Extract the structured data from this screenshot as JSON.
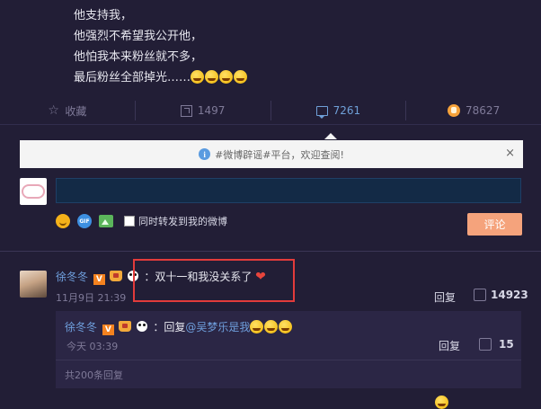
{
  "post": {
    "lines": [
      "他支持我，",
      "他强烈不希望我公开他，",
      "他怕我本来粉丝就不多，",
      "最后粉丝全部掉光……"
    ]
  },
  "actions": {
    "favorite": "收藏",
    "forward": "1497",
    "comment": "7261",
    "like": "78627"
  },
  "notice": {
    "text": "#微博辟谣#平台，欢迎查阅!",
    "close": "×"
  },
  "composer": {
    "input_value": "",
    "placeholder": "",
    "gif": "GIF",
    "repost_label": "同时转发到我的微博",
    "submit_label": "评论"
  },
  "comment": {
    "user": "徐冬冬",
    "badge": "V",
    "text": "：双十一和我没关系了",
    "heart": "❤",
    "time": "11月9日 21:39",
    "reply_label": "回复",
    "likes": "14923"
  },
  "sub_reply": {
    "user": "徐冬冬",
    "badge": "V",
    "reply_word": "：回复",
    "at_user": "@吴梦乐是我",
    "time": "今天 03:39",
    "reply_label": "回复",
    "likes": "15",
    "more": "共200条回复"
  },
  "colors": {
    "background": "#221e36",
    "link": "#6f9fdd",
    "submit": "#f5a37c",
    "highlight": "#e23b3b",
    "input": "#132a46"
  }
}
